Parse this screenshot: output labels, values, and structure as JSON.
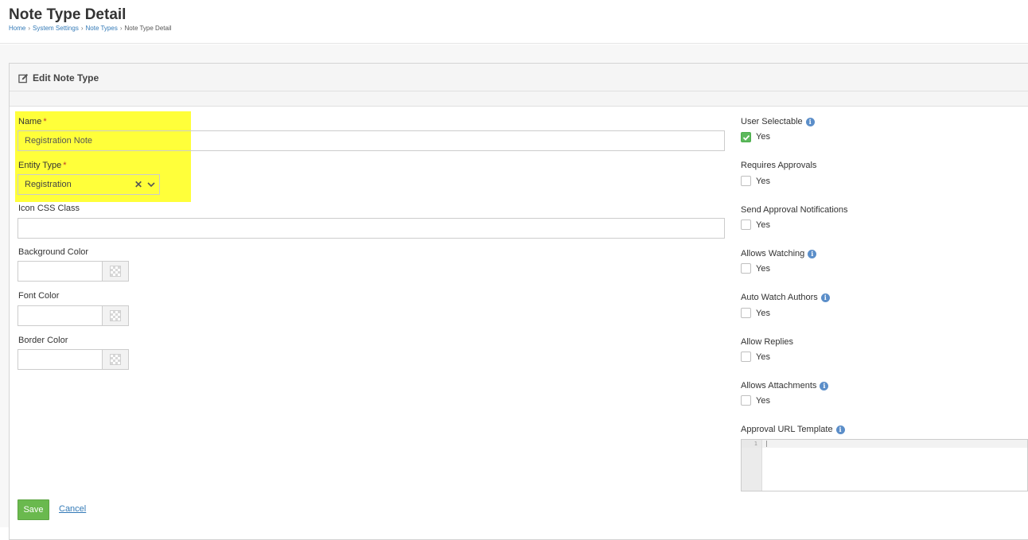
{
  "page": {
    "title": "Note Type Detail",
    "breadcrumb": [
      "Home",
      "System Settings",
      "Note Types",
      "Note Type Detail"
    ]
  },
  "panel": {
    "title": "Edit Note Type"
  },
  "form": {
    "name": {
      "label": "Name",
      "required_mark": "*",
      "value": "Registration Note"
    },
    "entity_type": {
      "label": "Entity Type",
      "required_mark": "*",
      "value": "Registration"
    },
    "icon_css_class": {
      "label": "Icon CSS Class",
      "value": ""
    },
    "background_color": {
      "label": "Background Color",
      "value": ""
    },
    "font_color": {
      "label": "Font Color",
      "value": ""
    },
    "border_color": {
      "label": "Border Color",
      "value": ""
    }
  },
  "options": {
    "user_selectable": {
      "label": "User Selectable",
      "check_label": "Yes",
      "checked": true
    },
    "requires_approvals": {
      "label": "Requires Approvals",
      "check_label": "Yes",
      "checked": false
    },
    "send_approval_notifications": {
      "label": "Send Approval Notifications",
      "check_label": "Yes",
      "checked": false
    },
    "allows_watching": {
      "label": "Allows Watching",
      "check_label": "Yes",
      "checked": false
    },
    "auto_watch_authors": {
      "label": "Auto Watch Authors",
      "check_label": "Yes",
      "checked": false
    },
    "allow_replies": {
      "label": "Allow Replies",
      "check_label": "Yes",
      "checked": false
    },
    "allows_attachments": {
      "label": "Allows Attachments",
      "check_label": "Yes",
      "checked": false
    }
  },
  "approval_url_template": {
    "label": "Approval URL Template",
    "line_number": "1",
    "value": ""
  },
  "actions": {
    "save_label": "Save",
    "cancel_label": "Cancel"
  },
  "colors": {
    "highlight": "#ffff3a",
    "save_button": "#6ab94e",
    "link": "#337ab7",
    "info_icon": "#5b8ec9",
    "required_mark": "#c0392b"
  }
}
